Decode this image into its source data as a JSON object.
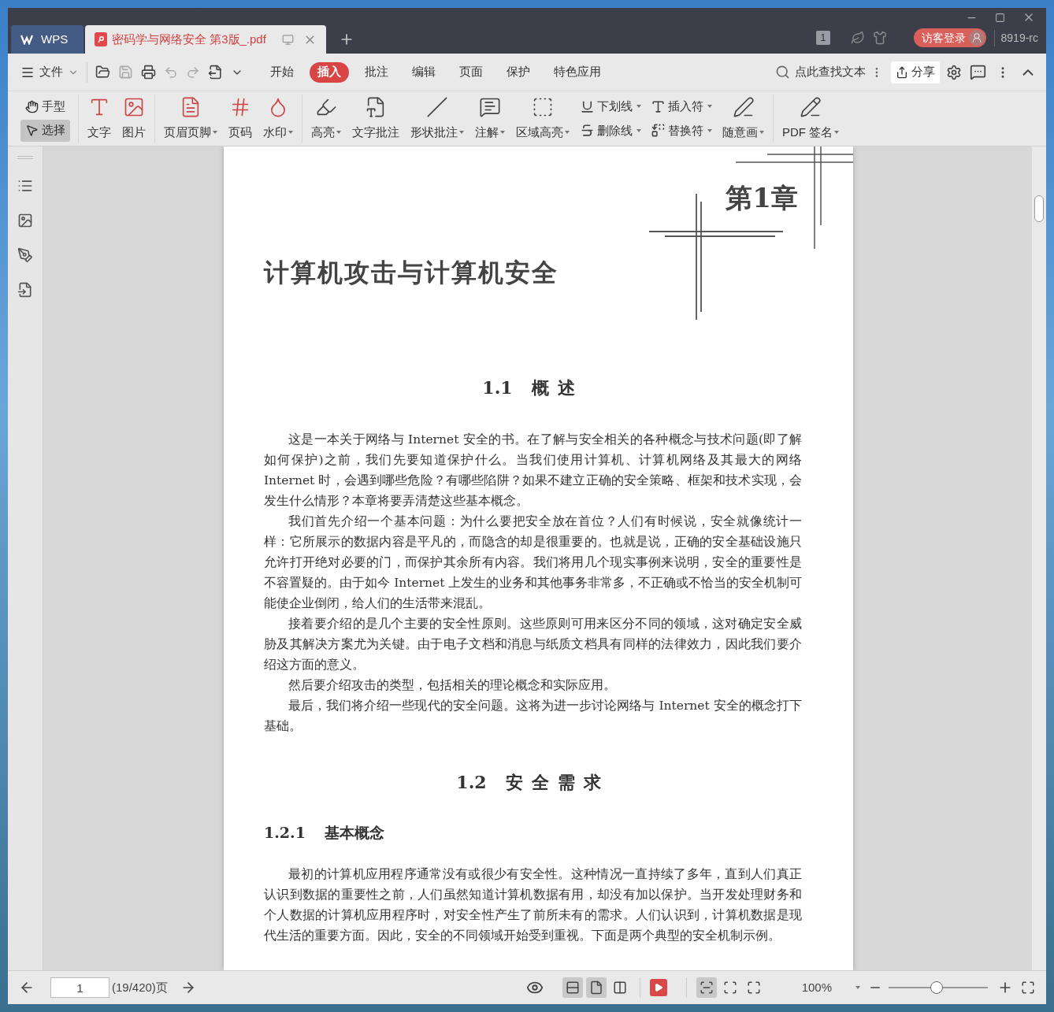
{
  "tabs": [
    {
      "kind": "home",
      "label": "WPS",
      "selected": false
    },
    {
      "kind": "document",
      "label": "密码学与网络安全 第3版_.pdf",
      "selected": true
    }
  ],
  "title_bar": {
    "page_badge": "1",
    "login_button": "访客登录",
    "user": "8919-rc"
  },
  "menu": {
    "file": "文件",
    "tabs": [
      {
        "label": "开始",
        "selected": false
      },
      {
        "label": "插入",
        "selected": true
      },
      {
        "label": "批注",
        "selected": false
      },
      {
        "label": "编辑",
        "selected": false
      },
      {
        "label": "页面",
        "selected": false
      },
      {
        "label": "保护",
        "selected": false
      },
      {
        "label": "特色应用",
        "selected": false
      }
    ],
    "search": {
      "placeholder": "点此查找文本"
    },
    "share": "分享"
  },
  "ribbon": {
    "mode_tools": [
      {
        "label": "手型",
        "selected": false
      },
      {
        "label": "选择",
        "selected": true
      }
    ],
    "groups": [
      [
        {
          "kind": "large",
          "label": "文字",
          "dropdown": false
        },
        {
          "kind": "large",
          "label": "图片",
          "dropdown": false
        }
      ],
      [
        {
          "kind": "large",
          "label": "页眉页脚",
          "dropdown": true
        },
        {
          "kind": "large",
          "label": "页码",
          "dropdown": false
        },
        {
          "kind": "large",
          "label": "水印",
          "dropdown": true
        }
      ],
      [
        {
          "kind": "large",
          "label": "高亮",
          "dropdown": true
        },
        {
          "kind": "large",
          "label": "文字批注",
          "dropdown": false
        },
        {
          "kind": "large",
          "label": "形状批注",
          "dropdown": true
        },
        {
          "kind": "large",
          "label": "注解",
          "dropdown": true
        },
        {
          "kind": "large",
          "label": "区域高亮",
          "dropdown": true
        },
        {
          "kind": "pair",
          "items": [
            {
              "label": "下划线",
              "dropdown": true
            },
            {
              "label": "删除线",
              "dropdown": true
            }
          ]
        },
        {
          "kind": "pair",
          "items": [
            {
              "label": "插入符",
              "dropdown": true
            },
            {
              "label": "替换符",
              "dropdown": true
            }
          ]
        },
        {
          "kind": "large",
          "label": "随意画",
          "dropdown": true
        }
      ],
      [
        {
          "kind": "large",
          "label": "PDF 签名",
          "dropdown": true
        }
      ]
    ]
  },
  "document": {
    "chapter": "第1章",
    "title": "计算机攻击与计算机安全",
    "blocks": [
      {
        "kind": "heading",
        "number": "1.1",
        "text": "概述"
      },
      {
        "kind": "paragraph",
        "text": "这是一本关于网络与 Internet 安全的书。在了解与安全相关的各种概念与技术问题(即了解如何保护)之前，我们先要知道保护什么。当我们使用计算机、计算机网络及其最大的网络 Internet 时，会遇到哪些危险？有哪些陷阱？如果不建立正确的安全策略、框架和技术实现，会发生什么情形？本章将要弄清楚这些基本概念。"
      },
      {
        "kind": "paragraph",
        "text": "我们首先介绍一个基本问题：为什么要把安全放在首位？人们有时候说，安全就像统计一样：它所展示的数据内容是平凡的，而隐含的却是很重要的。也就是说，正确的安全基础设施只允许打开绝对必要的门，而保护其余所有内容。我们将用几个现实事例来说明，安全的重要性是不容置疑的。由于如今 Internet 上发生的业务和其他事务非常多，不正确或不恰当的安全机制可能使企业倒闭，给人们的生活带来混乱。"
      },
      {
        "kind": "paragraph",
        "text": "接着要介绍的是几个主要的安全性原则。这些原则可用来区分不同的领域，这对确定安全威胁及其解决方案尤为关键。由于电子文档和消息与纸质文档具有同样的法律效力，因此我们要介绍这方面的意义。"
      },
      {
        "kind": "paragraph",
        "text": "然后要介绍攻击的类型，包括相关的理论概念和实际应用。"
      },
      {
        "kind": "paragraph",
        "text": "最后，我们将介绍一些现代的安全问题。这将为进一步讨论网络与 Internet 安全的概念打下基础。"
      },
      {
        "kind": "heading",
        "number": "1.2",
        "text": "安全需求"
      },
      {
        "kind": "subheading",
        "number": "1.2.1",
        "text": "基本概念"
      },
      {
        "kind": "paragraph",
        "text": "最初的计算机应用程序通常没有或很少有安全性。这种情况一直持续了多年，直到人们真正认识到数据的重要性之前，人们虽然知道计算机数据有用，却没有加以保护。当开发处理财务和个人数据的计算机应用程序时，对安全性产生了前所未有的需求。人们认识到，计算机数据是现代生活的重要方面。因此，安全的不同领域开始受到重视。下面是两个典型的安全机制示例。"
      }
    ]
  },
  "status_bar": {
    "page_input": "1",
    "page_count": "(19/420)页",
    "view_modes": [
      {
        "selected": true
      },
      {
        "selected": true
      },
      {
        "selected": false
      }
    ],
    "fit_modes": [
      {
        "selected": true
      },
      {
        "selected": false
      },
      {
        "selected": false
      }
    ],
    "zoom": "100%",
    "zoom_slider": {
      "level": 0.48
    }
  }
}
